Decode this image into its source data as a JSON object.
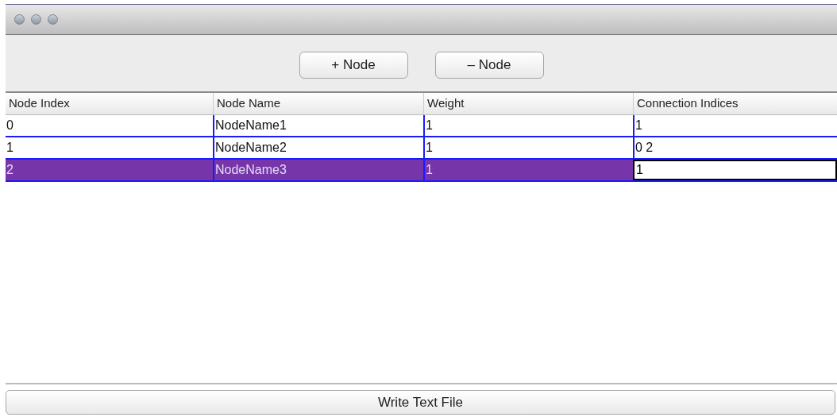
{
  "toolbar": {
    "buttons": [
      "+ Node",
      "– Node"
    ]
  },
  "table": {
    "columns": [
      "Node Index",
      "Node Name",
      "Weight",
      "Connection Indices"
    ],
    "rows": [
      {
        "selected": false,
        "cells": [
          {
            "text": "0",
            "editing": false
          },
          {
            "text": "NodeName1",
            "editing": false
          },
          {
            "text": "1",
            "editing": false
          },
          {
            "text": "1",
            "editing": false
          }
        ]
      },
      {
        "selected": false,
        "cells": [
          {
            "text": "1",
            "editing": false
          },
          {
            "text": "NodeName2",
            "editing": false
          },
          {
            "text": "1",
            "editing": false
          },
          {
            "text": "0 2",
            "editing": false
          }
        ]
      },
      {
        "selected": true,
        "cells": [
          {
            "text": "2",
            "editing": false
          },
          {
            "text": "NodeName3",
            "editing": false
          },
          {
            "text": "1",
            "editing": false
          },
          {
            "text": "1",
            "editing": true
          }
        ]
      }
    ]
  },
  "footer": {
    "button": "Write Text File"
  }
}
